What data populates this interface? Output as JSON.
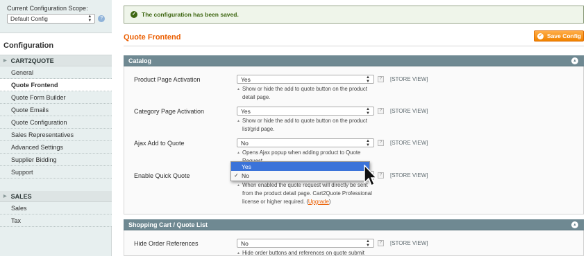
{
  "sidebar": {
    "scope_label": "Current Configuration Scope:",
    "scope_value": "Default Config",
    "title": "Configuration",
    "groups": [
      {
        "label": "CART2QUOTE",
        "items": [
          "General",
          "Quote Frontend",
          "Quote Form Builder",
          "Quote Emails",
          "Quote Configuration",
          "Sales Representatives",
          "Advanced Settings",
          "Supplier Bidding",
          "Support"
        ]
      },
      {
        "label": "SALES",
        "items": [
          "Sales",
          "Tax"
        ]
      }
    ]
  },
  "message": "The configuration has been saved.",
  "page_title": "Quote Frontend",
  "save_label": "Save Config",
  "sections": {
    "catalog": {
      "title": "Catalog",
      "rows": [
        {
          "label": "Product Page Activation",
          "value": "Yes",
          "scope": "[STORE VIEW]",
          "note1": "Show or hide the add to quote button on the product",
          "note2": "detail page."
        },
        {
          "label": "Category Page Activation",
          "value": "Yes",
          "scope": "[STORE VIEW]",
          "note1": "Show or hide the add to quote button on the product",
          "note2": "list/grid page."
        },
        {
          "label": "Ajax Add to Quote",
          "value": "No",
          "scope": "[STORE VIEW]",
          "note1": "Opens Ajax popup when adding product to Quote",
          "note2": "Request"
        },
        {
          "label": "Enable Quick Quote",
          "value": "No",
          "scope": "[STORE VIEW]",
          "note1": "When enabled the quote request will directly be sent",
          "note2": "from the product detail page. Cart2Quote Professional",
          "note3": "license or higher required. (",
          "link": "Upgrade",
          "note3_end": ")"
        }
      ]
    },
    "shopping": {
      "title": "Shopping Cart / Quote List",
      "rows": [
        {
          "label": "Hide Order References",
          "value": "No",
          "scope": "[STORE VIEW]",
          "note1": "Hide order buttons and references on quote submit"
        }
      ]
    }
  },
  "dropdown": {
    "options": [
      "Yes",
      "No"
    ],
    "highlighted": "Yes",
    "checked": "No",
    "check_mark": "✓"
  },
  "colors": {
    "accent": "#eb5e00",
    "section_header": "#6f8992",
    "success_text": "#3d6611",
    "highlight": "#3b73d9"
  }
}
